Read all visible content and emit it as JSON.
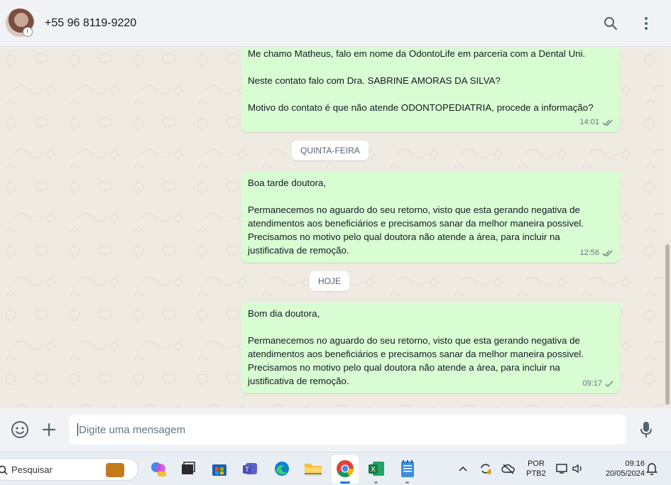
{
  "header": {
    "contact_name": "+55 96 8119-9220",
    "icons": [
      "search-icon",
      "menu-icon"
    ]
  },
  "messages": [
    {
      "paragraphs": [
        "Me chamo Matheus, falo em nome da OdontoLife em parceria com a Dental Uni.",
        "Neste contato falo com Dra. SABRINE AMORAS DA SILVA?",
        "Motivo do contato é que não atende ODONTOPEDIATRIA, procede a informação?"
      ],
      "time": "14:01",
      "status": "delivered"
    },
    {
      "paragraphs": [
        "Boa tarde doutora,",
        "Permanecemos no aguardo do seu retorno, visto que esta gerando negativa de atendimentos aos beneficiários e precisamos sanar da melhor maneira possivel. Precisamos no motivo pelo qual doutora não atende a área, para incluir na justificativa de remoção."
      ],
      "time": "12:56",
      "status": "delivered"
    },
    {
      "paragraphs": [
        "Bom dia doutora,",
        "Permanecemos no aguardo do seu retorno, visto que esta gerando negativa de atendimentos aos beneficiários e precisamos sanar da melhor maneira possivel. Precisamos no motivo pelo qual doutora não atende a área, para incluir na justificativa de remoção."
      ],
      "time": "09:17",
      "status": "sent"
    }
  ],
  "day_labels": [
    "QUINTA-FEIRA",
    "HOJE"
  ],
  "composer": {
    "placeholder": "Digite uma mensagem",
    "icons": [
      "emoji-icon",
      "plus-icon",
      "microphone-icon"
    ]
  },
  "taskbar": {
    "search_label": "Pesquisar",
    "apps": [
      "copilot-icon",
      "task-view-icon",
      "store-icon",
      "teams-icon",
      "edge-icon",
      "file-explorer-icon",
      "chrome-icon",
      "excel-icon",
      "notepad-icon"
    ],
    "tray": {
      "lang_top": "POR",
      "lang_bottom": "PTB2",
      "time": "09:16",
      "date": "20/05/2024"
    }
  },
  "colors": {
    "bubble_out": "#d9fdd3",
    "chat_bg": "#efeae2",
    "header_bg": "#f0f2f5",
    "tick_delivered": "#667781"
  }
}
